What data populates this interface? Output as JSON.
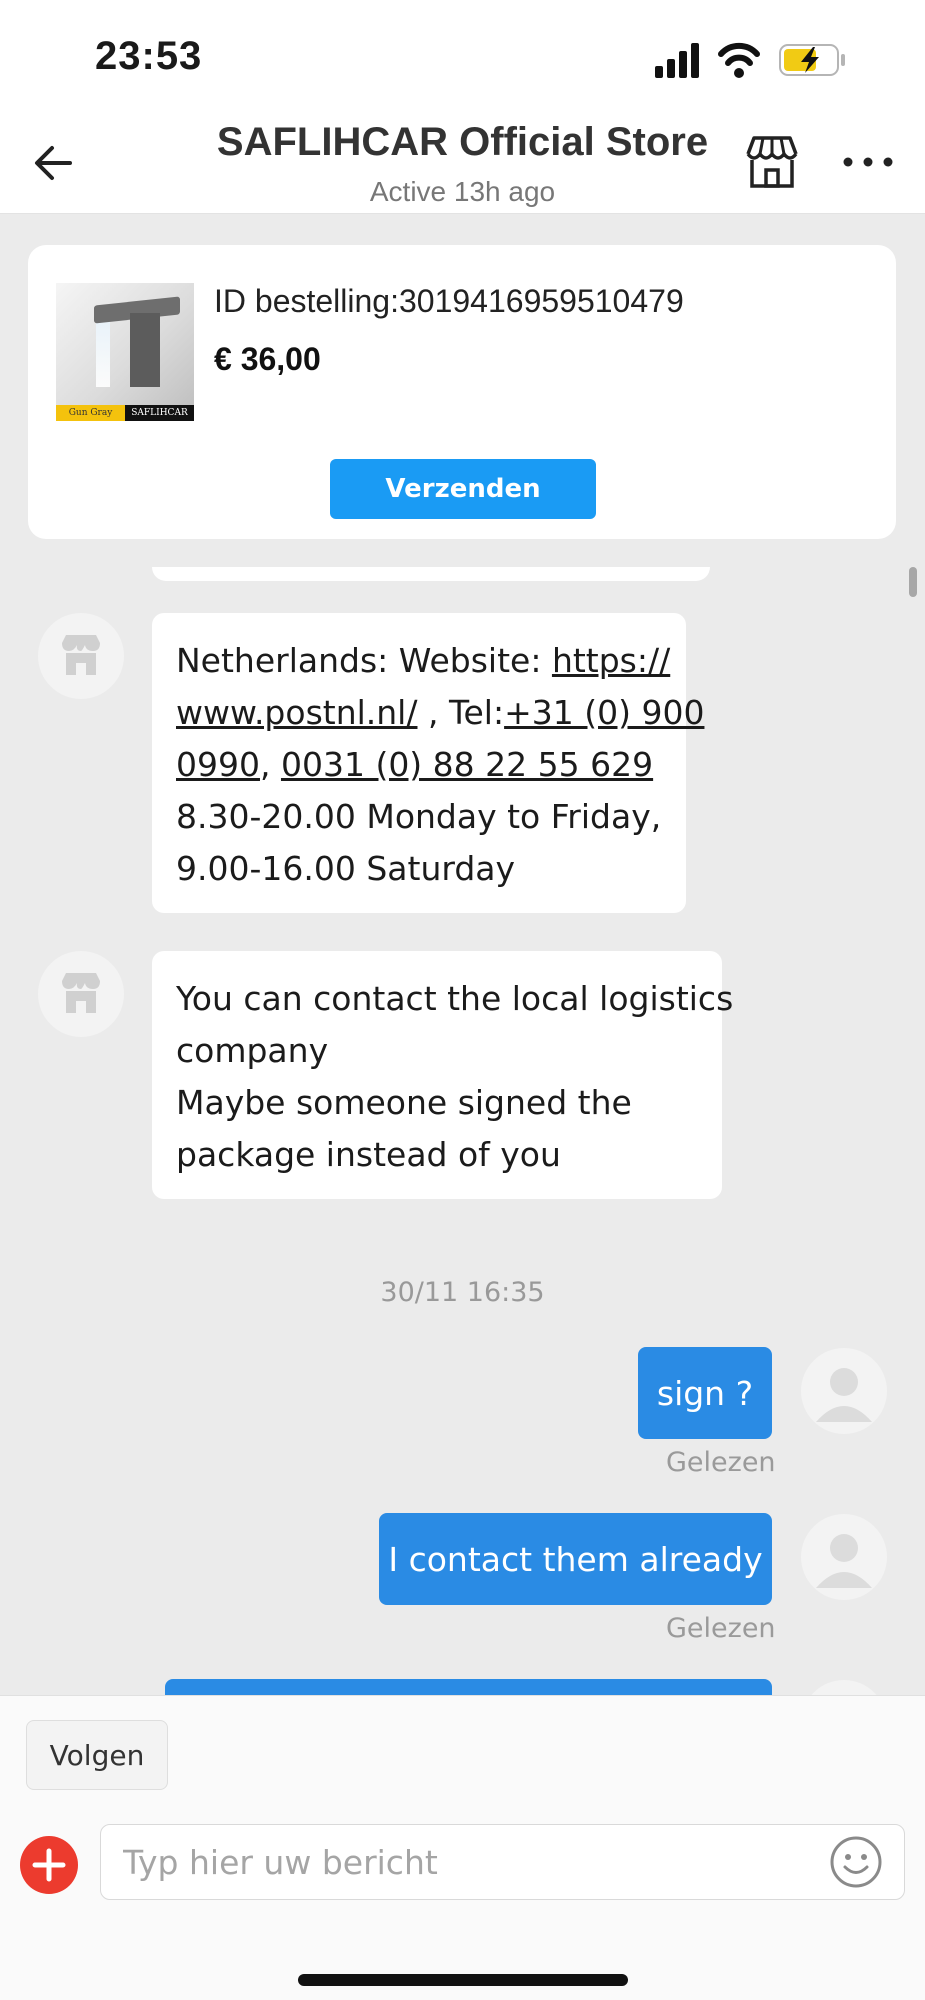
{
  "status_bar": {
    "time": "23:53"
  },
  "header": {
    "title": "SAFLIHCAR Official Store",
    "subtitle": "Active 13h ago"
  },
  "order": {
    "id_text": "ID bestelling:3019416959510479",
    "price": "€ 36,00",
    "send_label": "Verzenden",
    "thumb_left_label": "Gun Gray",
    "thumb_right_label": "SAFLIHCAR"
  },
  "messages": {
    "incoming_1": {
      "line1_prefix": "Netherlands: Website: ",
      "line1_link": "https://",
      "line2_link": "www.postnl.nl/",
      "line2_text": " , Tel:",
      "line2_phone": "+31 (0) 900",
      "line3_phone_a": "0990",
      "line3_sep": ", ",
      "line3_phone_b": "0031 (0) 88 22 55 629",
      "line4": "8.30-20.00 Monday to Friday,",
      "line5": "9.00-16.00 Saturday"
    },
    "incoming_2": {
      "line1": "You can contact the local logistics",
      "line2": "company",
      "line3": "Maybe someone signed the",
      "line4": "package instead of you"
    },
    "timestamp": "30/11 16:35",
    "outgoing_1": {
      "text": "sign ?",
      "status": "Gelezen"
    },
    "outgoing_2": {
      "text": "I contact them already",
      "status": "Gelezen"
    }
  },
  "bottom": {
    "follow_label": "Volgen",
    "input_placeholder": "Typ hier uw bericht"
  },
  "colors": {
    "accent_blue": "#1a9bf4",
    "bubble_blue": "#2a8be4",
    "plus_red": "#ec3b2e"
  }
}
